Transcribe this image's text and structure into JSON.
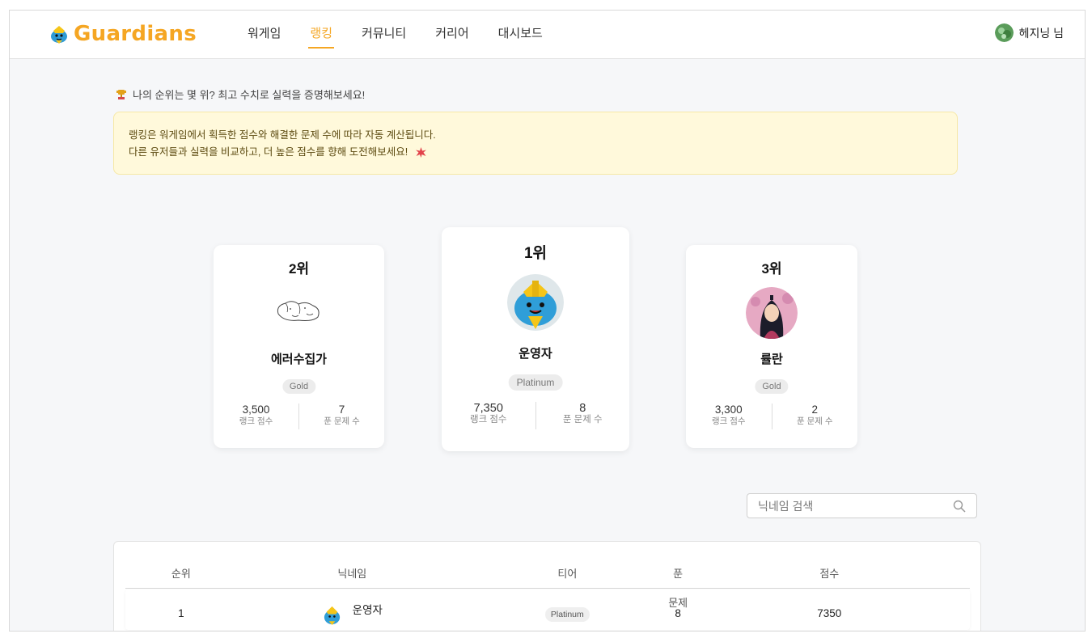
{
  "header": {
    "logo_text": "Guardians",
    "nav": [
      "워게임",
      "랭킹",
      "커뮤니티",
      "커리어",
      "대시보드"
    ],
    "active_nav": "랭킹",
    "user_label": "헤지닝 님"
  },
  "intro": {
    "headline": "나의 순위는 몇 위? 최고 수치로 실력을 증명해보세요!",
    "notice_line1": "랭킹은 워게임에서 획득한 점수와 해결한 문제 수에 따라 자동 계산됩니다.",
    "notice_line2": "다른 유저들과 실력을 비교하고, 더 높은 점수를 향해 도전해보세요!"
  },
  "podium": {
    "first": {
      "rank": "1위",
      "name": "운영자",
      "tier": "Platinum",
      "score": "7,350",
      "solved": "8"
    },
    "second": {
      "rank": "2위",
      "name": "에러수집가",
      "tier": "Gold",
      "score": "3,500",
      "solved": "7"
    },
    "third": {
      "rank": "3위",
      "name": "률란",
      "tier": "Gold",
      "score": "3,300",
      "solved": "2"
    },
    "score_label": "랭크 점수",
    "solved_label": "푼 문제 수"
  },
  "search": {
    "placeholder": "닉네임 검색"
  },
  "table": {
    "headers": [
      "순위",
      "닉네임",
      "티어",
      "푼 문제",
      "점수"
    ],
    "rows": [
      {
        "rank": "1",
        "name": "운영자",
        "tier": "Platinum",
        "solved": "8",
        "score": "7350"
      }
    ]
  },
  "colors": {
    "accent": "#f5a623",
    "notice_bg": "#fff9db",
    "page_bg": "#f6f7f9"
  }
}
